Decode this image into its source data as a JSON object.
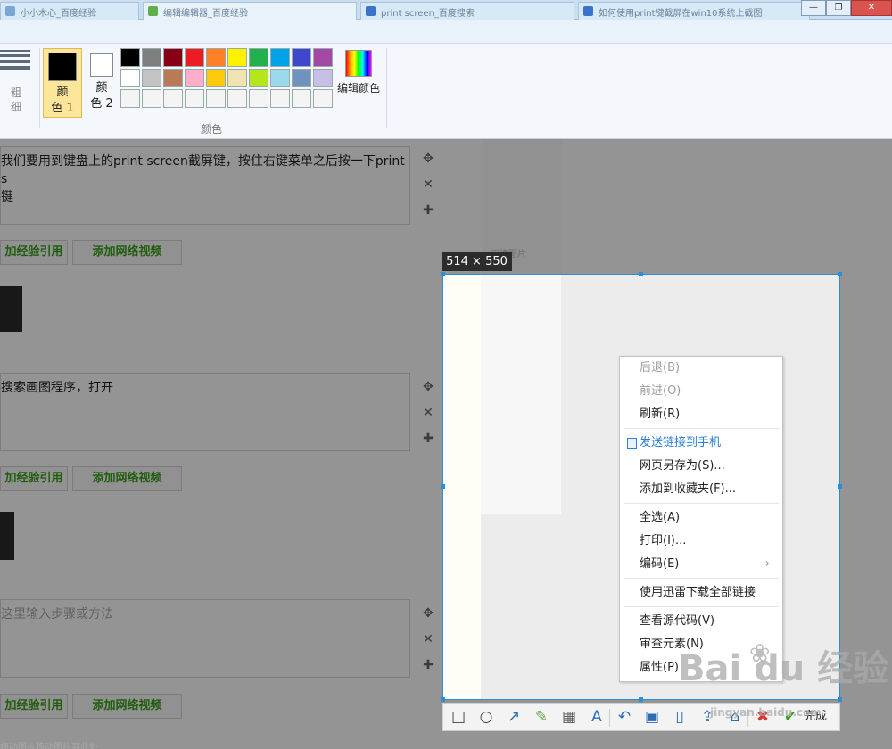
{
  "window": {
    "tabs": [
      "小小木心_百度经验",
      "编辑编辑器_百度经验",
      "print screen_百度搜索",
      "如何使用print键截屏在win10系统上截图"
    ],
    "controls": [
      "—",
      "❐",
      "✕"
    ]
  },
  "ribbon": {
    "size_label": "粗\n细",
    "color1_label": "颜\n色 1",
    "color2_label": "颜\n色 2",
    "edit_colors_label": "编辑颜色",
    "group_label": "颜色",
    "color1_value": "#000000",
    "color2_value": "#ffffff",
    "palette": [
      "#000000",
      "#7f7f7f",
      "#880015",
      "#ed1c24",
      "#ff7f27",
      "#fff200",
      "#22b14c",
      "#00a2e8",
      "#3f48cc",
      "#a349a4",
      "#ffffff",
      "#c3c3c3",
      "#b97a57",
      "#ffaec9",
      "#ffc90e",
      "#efe4b0",
      "#b5e61d",
      "#99d9ea",
      "#7092be",
      "#c8bfe7",
      "#f4f4f4",
      "#f4f4f4",
      "#f4f4f4",
      "#f4f4f4",
      "#f4f4f4",
      "#f4f4f4",
      "#f4f4f4",
      "#f4f4f4",
      "#f4f4f4",
      "#f4f4f4"
    ]
  },
  "editor": {
    "steps": [
      {
        "text": "我们要用到键盘上的print screen截屏键，按住右键菜单之后按一下print s\n键",
        "placeholder": false
      },
      {
        "text": "搜索画图程序，打开",
        "placeholder": false
      },
      {
        "text": "这里输入步骤或方法",
        "placeholder": true
      }
    ],
    "step_controls": [
      "✥",
      "✕",
      "✚"
    ],
    "add_ref_label": "加经验引用",
    "add_video_label": "添加网络视频",
    "side_hint": "更换图片",
    "bottom_note": "拖动图片移动图片到此处"
  },
  "capture": {
    "size_label": "514 × 550",
    "done_label": "完成",
    "tools": [
      "rect-tool-icon",
      "ellipse-tool-icon",
      "arrow-tool-icon",
      "pen-tool-icon",
      "mosaic-tool-icon",
      "text-tool-icon",
      "undo-icon",
      "save-icon",
      "phone-icon",
      "share-icon",
      "pin-icon",
      "cancel-icon",
      "confirm-icon"
    ],
    "tool_glyphs": [
      "□",
      "○",
      "↗",
      "✎",
      "▦",
      "A",
      "↶",
      "▣",
      "▯",
      "⇪",
      "⌂",
      "✖",
      "✔"
    ]
  },
  "context_menu": {
    "groups": [
      [
        {
          "label": "后退(B)",
          "disabled": true
        },
        {
          "label": "前进(O)",
          "disabled": true
        },
        {
          "label": "刷新(R)",
          "disabled": false
        }
      ],
      [
        {
          "label": "发送链接到手机",
          "disabled": false,
          "highlight": true
        },
        {
          "label": "网页另存为(S)...",
          "disabled": false
        },
        {
          "label": "添加到收藏夹(F)...",
          "disabled": false
        }
      ],
      [
        {
          "label": "全选(A)",
          "disabled": false
        },
        {
          "label": "打印(I)...",
          "disabled": false
        },
        {
          "label": "编码(E)",
          "disabled": false,
          "submenu": true
        }
      ],
      [
        {
          "label": "使用迅雷下载全部链接",
          "disabled": false
        }
      ],
      [
        {
          "label": "查看源代码(V)",
          "disabled": false
        },
        {
          "label": "审查元素(N)",
          "disabled": false
        },
        {
          "label": "属性(P)",
          "disabled": false
        }
      ]
    ]
  },
  "watermark": {
    "logo": "Bai du 经验",
    "url": "jingyan.baidu.com"
  }
}
